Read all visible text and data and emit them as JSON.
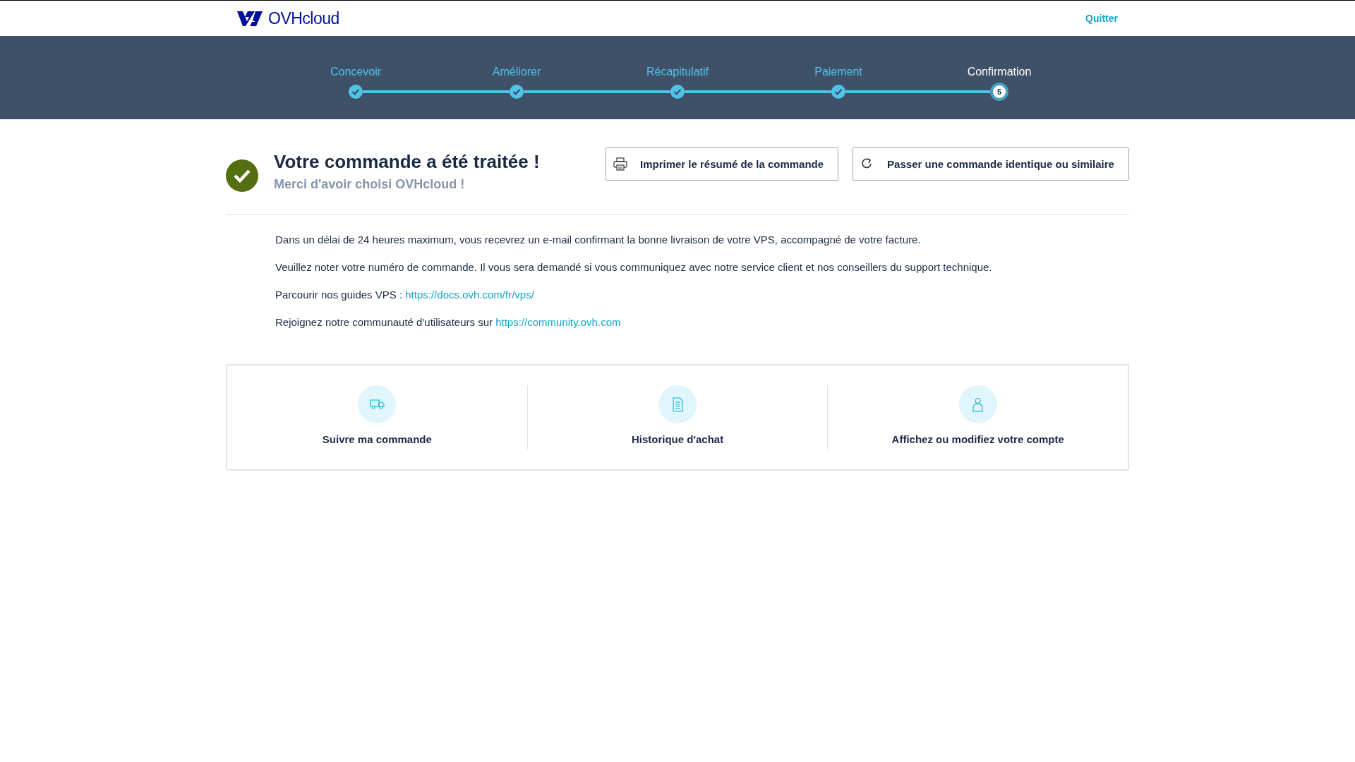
{
  "header": {
    "logo": "OVHcloud",
    "quit_link": "Quitter"
  },
  "steps": [
    {
      "label": "Concevoir",
      "completed": true,
      "current": false
    },
    {
      "label": "Améliorer",
      "completed": true,
      "current": false
    },
    {
      "label": "Récapitulatif",
      "completed": true,
      "current": false
    },
    {
      "label": "Paiement",
      "completed": true,
      "current": false
    },
    {
      "label": "Confirmation",
      "completed": false,
      "current": true,
      "number": "5"
    }
  ],
  "confirmation": {
    "title": "Votre commande a été traitée !",
    "subtitle": "Merci d'avoir choisi OVHcloud !"
  },
  "buttons": [
    {
      "label": "Imprimer le résumé de la commande",
      "kind": "print"
    },
    {
      "label": "Passer une commande identique ou similaire",
      "kind": "reorder"
    }
  ],
  "paragraphs": [
    {
      "text": "Dans un délai de 24 heures maximum, vous recevrez un e-mail confirmant la bonne livraison de votre VPS, accompagné de votre facture."
    },
    {
      "text": "Veuillez noter votre numéro de commande. Il vous sera demandé si vous communiquez avec notre service client et nos conseillers du support technique."
    },
    {
      "text": "Parcourir nos guides VPS : ",
      "link": "https://docs.ovh.com/fr/vps/"
    },
    {
      "text": "Rejoignez notre communauté d'utilisateurs sur ",
      "link": "https://community.ovh.com"
    }
  ],
  "actions": [
    {
      "label": "Suivre ma commande",
      "kind": "truck"
    },
    {
      "label": "Historique d'achat",
      "kind": "document"
    },
    {
      "label": "Affichez ou modifiez votre compte",
      "kind": "person"
    }
  ]
}
